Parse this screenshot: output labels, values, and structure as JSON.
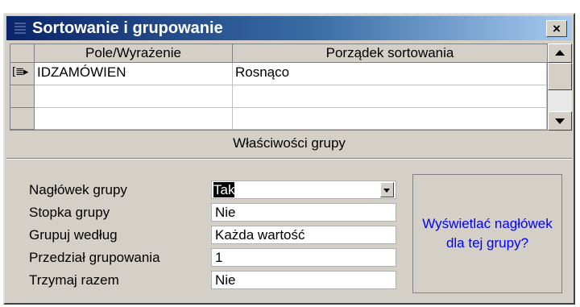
{
  "window": {
    "title": "Sortowanie i grupowanie",
    "close_glyph": "×",
    "icon": "sorting-grouping-icon"
  },
  "grid": {
    "headers": [
      "Pole/Wyrażenie",
      "Porządek sortowania"
    ],
    "current_row_indicator": "[≣▸",
    "rows": [
      {
        "field": "IDZAMÓWIEN",
        "order": "Rosnąco"
      },
      {
        "field": "",
        "order": ""
      },
      {
        "field": "",
        "order": ""
      }
    ]
  },
  "group_properties": {
    "title": "Właściwości grupy",
    "items": [
      {
        "label": "Nagłówek grupy",
        "value": "Tak"
      },
      {
        "label": "Stopka grupy",
        "value": "Nie"
      },
      {
        "label": "Grupuj według",
        "value": "Każda wartość"
      },
      {
        "label": "Przedział grupowania",
        "value": "1"
      },
      {
        "label": "Trzymaj razem",
        "value": "Nie"
      }
    ],
    "hint": "Wyświetlać nagłówek dla tej grupy?"
  },
  "colors": {
    "title_start": "#0a246a",
    "title_end": "#a6caf0",
    "hint_text": "#0000ff",
    "face": "#d4d0c8"
  }
}
